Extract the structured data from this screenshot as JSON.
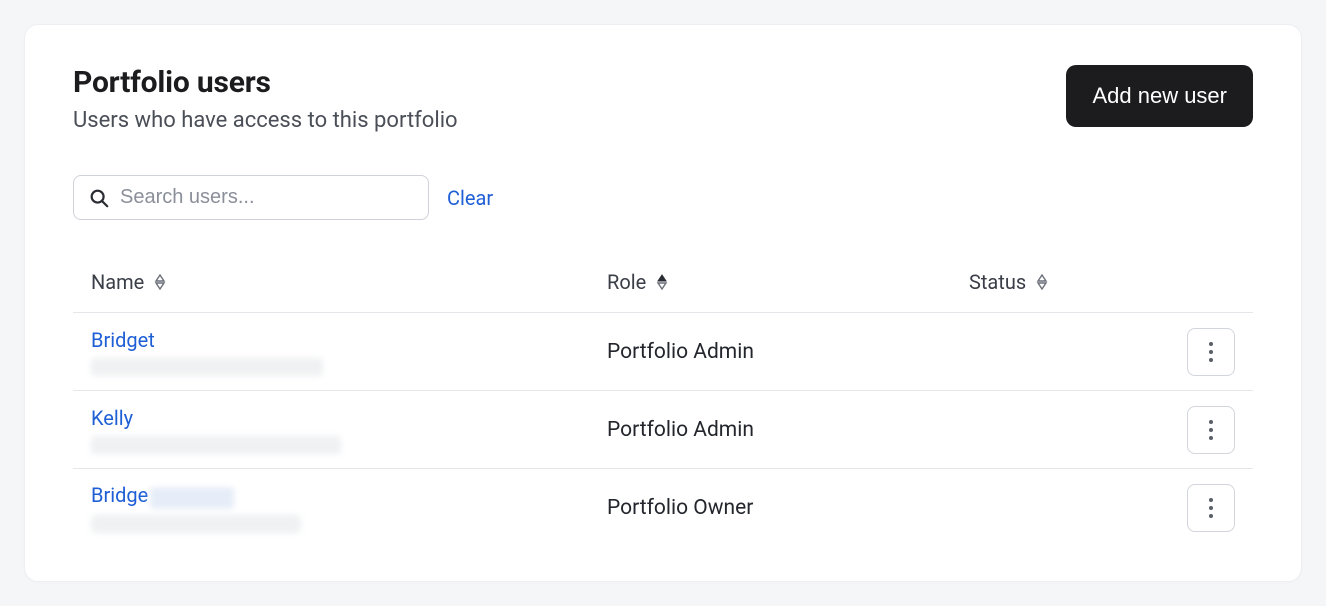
{
  "header": {
    "title": "Portfolio users",
    "subtitle": "Users who have access to this portfolio",
    "add_button_label": "Add new user"
  },
  "search": {
    "placeholder": "Search users...",
    "clear_label": "Clear"
  },
  "table": {
    "columns": {
      "name": "Name",
      "role": "Role",
      "status": "Status"
    },
    "sort": {
      "active_column": "role",
      "direction": "asc"
    },
    "rows": [
      {
        "name": "Bridget",
        "role": "Portfolio Admin",
        "status": "",
        "sub_blur_width": 232,
        "name_blur_width": 0
      },
      {
        "name": "Kelly",
        "role": "Portfolio Admin",
        "status": "",
        "sub_blur_width": 250,
        "name_blur_width": 0
      },
      {
        "name": "Bridge",
        "role": "Portfolio Owner",
        "status": "",
        "sub_blur_width": 210,
        "name_blur_width": 84
      }
    ]
  }
}
